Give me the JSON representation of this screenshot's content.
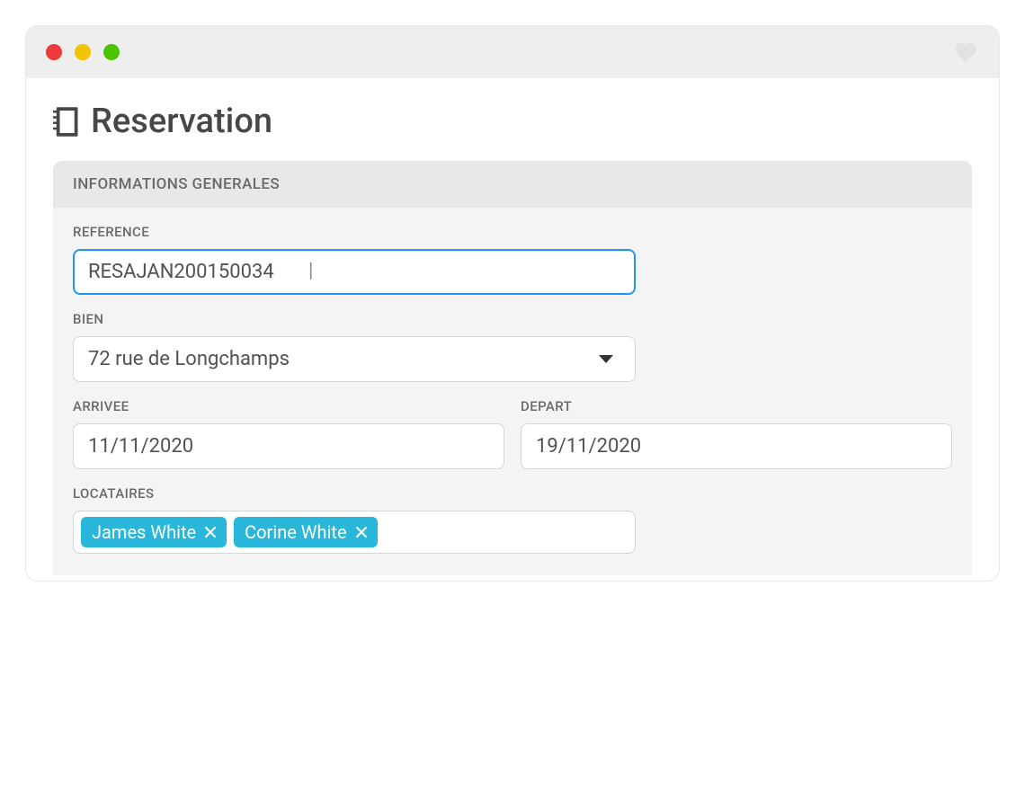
{
  "page": {
    "title": "Reservation"
  },
  "section": {
    "header": "INFORMATIONS GENERALES",
    "fields": {
      "reference": {
        "label": "REFERENCE",
        "value": "RESAJAN200150034"
      },
      "bien": {
        "label": "BIEN",
        "value": "72 rue de Longchamps"
      },
      "arrivee": {
        "label": "ARRIVEE",
        "value": "11/11/2020"
      },
      "depart": {
        "label": "DEPART",
        "value": "19/11/2020"
      },
      "locataires": {
        "label": "LOCATAIRES",
        "tags": [
          {
            "name": "James White"
          },
          {
            "name": "Corine White"
          }
        ]
      }
    }
  }
}
